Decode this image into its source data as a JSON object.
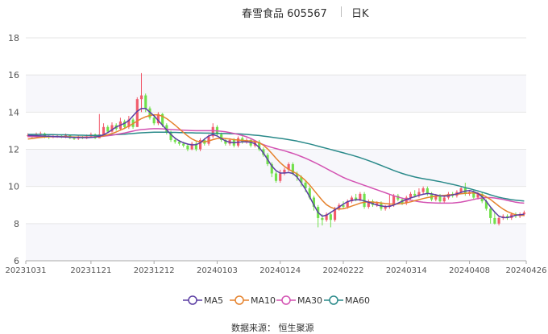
{
  "header": {
    "title": "春雪食品 605567",
    "period": "日K"
  },
  "source": "数据来源： 恒生聚源",
  "colors": {
    "up": "#f15b6c",
    "down": "#71e04b",
    "ma5": "#5b3ea3",
    "ma10": "#e5822d",
    "ma30": "#d352b2",
    "ma60": "#2a8a8a",
    "grid": "#e6e6e6",
    "plot_bg_odd": "#f7f7fb"
  },
  "chart_data": {
    "type": "candlestick",
    "ylim": [
      6,
      18
    ],
    "yticks": [
      "6",
      "8",
      "10",
      "12",
      "14",
      "16",
      "18"
    ],
    "xticks": [
      "20231031",
      "20231121",
      "20231212",
      "20240103",
      "20240124",
      "20240222",
      "20240314",
      "20240408",
      "20240426"
    ],
    "xtick_index": [
      0,
      15,
      30,
      45,
      60,
      75,
      90,
      105,
      117
    ],
    "legend": [
      "MA5",
      "MA10",
      "MA30",
      "MA60"
    ],
    "candles": [
      [
        12.75,
        12.75,
        12.86,
        12.65
      ],
      [
        12.75,
        12.7,
        12.8,
        12.6
      ],
      [
        12.7,
        12.8,
        12.9,
        12.65
      ],
      [
        12.8,
        12.85,
        12.95,
        12.75
      ],
      [
        12.85,
        12.7,
        12.9,
        12.6
      ],
      [
        12.7,
        12.65,
        12.8,
        12.55
      ],
      [
        12.65,
        12.7,
        12.8,
        12.6
      ],
      [
        12.7,
        12.72,
        12.82,
        12.62
      ],
      [
        12.72,
        12.68,
        12.8,
        12.6
      ],
      [
        12.68,
        12.75,
        12.85,
        12.6
      ],
      [
        12.75,
        12.6,
        12.8,
        12.55
      ],
      [
        12.6,
        12.58,
        12.7,
        12.5
      ],
      [
        12.58,
        12.66,
        12.75,
        12.5
      ],
      [
        12.66,
        12.6,
        12.72,
        12.55
      ],
      [
        12.6,
        12.7,
        12.8,
        12.55
      ],
      [
        12.7,
        12.8,
        12.9,
        12.65
      ],
      [
        12.8,
        12.6,
        12.85,
        12.55
      ],
      [
        12.6,
        12.8,
        13.9,
        12.6
      ],
      [
        12.8,
        13.2,
        13.4,
        12.75
      ],
      [
        13.2,
        12.95,
        13.3,
        12.9
      ],
      [
        12.95,
        13.3,
        13.45,
        12.9
      ],
      [
        13.3,
        13.1,
        13.4,
        13.0
      ],
      [
        13.1,
        13.5,
        13.7,
        13.0
      ],
      [
        13.5,
        13.2,
        13.6,
        13.1
      ],
      [
        13.2,
        13.6,
        13.8,
        13.1
      ],
      [
        13.6,
        13.2,
        13.7,
        13.1
      ],
      [
        13.2,
        14.7,
        14.8,
        13.2
      ],
      [
        14.7,
        14.9,
        16.1,
        14.0
      ],
      [
        14.9,
        14.2,
        15.0,
        14.0
      ],
      [
        14.2,
        13.7,
        14.3,
        13.6
      ],
      [
        13.7,
        13.4,
        13.8,
        13.3
      ],
      [
        13.4,
        13.9,
        14.0,
        13.3
      ],
      [
        13.9,
        13.3,
        13.95,
        13.2
      ],
      [
        13.3,
        12.9,
        13.4,
        12.8
      ],
      [
        12.9,
        12.5,
        13.0,
        12.4
      ],
      [
        12.5,
        12.4,
        12.6,
        12.3
      ],
      [
        12.4,
        12.3,
        12.5,
        12.2
      ],
      [
        12.3,
        12.2,
        12.4,
        12.1
      ],
      [
        12.2,
        12.0,
        12.3,
        11.9
      ],
      [
        12.0,
        12.3,
        12.4,
        11.95
      ],
      [
        12.3,
        12.0,
        12.4,
        11.9
      ],
      [
        12.0,
        12.5,
        12.6,
        11.9
      ],
      [
        12.5,
        12.3,
        12.6,
        12.2
      ],
      [
        12.3,
        12.7,
        12.8,
        12.2
      ],
      [
        12.7,
        13.2,
        13.4,
        12.6
      ],
      [
        13.2,
        12.8,
        13.3,
        12.7
      ],
      [
        12.8,
        12.5,
        12.9,
        12.4
      ],
      [
        12.5,
        12.3,
        12.6,
        12.2
      ],
      [
        12.3,
        12.5,
        12.6,
        12.2
      ],
      [
        12.5,
        12.2,
        12.6,
        12.1
      ],
      [
        12.2,
        12.6,
        12.7,
        12.1
      ],
      [
        12.6,
        12.4,
        12.7,
        12.3
      ],
      [
        12.4,
        12.5,
        12.6,
        12.3
      ],
      [
        12.5,
        12.2,
        12.6,
        12.1
      ],
      [
        12.2,
        12.4,
        12.5,
        12.1
      ],
      [
        12.4,
        12.0,
        12.5,
        11.9
      ],
      [
        12.0,
        11.7,
        12.1,
        11.6
      ],
      [
        11.7,
        11.2,
        11.8,
        11.1
      ],
      [
        11.2,
        10.7,
        11.3,
        10.5
      ],
      [
        10.7,
        10.3,
        10.8,
        10.2
      ],
      [
        10.3,
        10.7,
        10.9,
        10.2
      ],
      [
        10.7,
        10.9,
        11.0,
        10.6
      ],
      [
        10.9,
        11.2,
        11.3,
        10.8
      ],
      [
        11.2,
        10.7,
        11.3,
        10.6
      ],
      [
        10.7,
        10.5,
        10.8,
        10.3
      ],
      [
        10.5,
        10.2,
        10.6,
        10.0
      ],
      [
        10.2,
        9.9,
        10.3,
        9.7
      ],
      [
        9.9,
        9.4,
        10.0,
        9.3
      ],
      [
        9.4,
        8.9,
        9.5,
        8.7
      ],
      [
        8.9,
        8.3,
        9.0,
        7.8
      ],
      [
        8.3,
        8.2,
        8.5,
        7.9
      ],
      [
        8.2,
        8.5,
        8.6,
        8.1
      ],
      [
        8.5,
        8.2,
        8.6,
        7.8
      ],
      [
        8.2,
        8.8,
        8.9,
        8.1
      ],
      [
        8.8,
        9.0,
        9.1,
        8.7
      ],
      [
        9.0,
        8.9,
        9.2,
        8.8
      ],
      [
        8.9,
        9.2,
        9.3,
        8.8
      ],
      [
        9.2,
        9.4,
        9.5,
        9.1
      ],
      [
        9.4,
        9.3,
        9.6,
        9.2
      ],
      [
        9.3,
        9.6,
        9.7,
        9.2
      ],
      [
        9.6,
        8.9,
        9.7,
        8.8
      ],
      [
        8.9,
        9.2,
        9.3,
        8.8
      ],
      [
        9.2,
        9.0,
        9.3,
        8.9
      ],
      [
        9.0,
        9.1,
        9.2,
        8.9
      ],
      [
        9.1,
        8.8,
        9.2,
        8.7
      ],
      [
        8.8,
        8.9,
        9.0,
        8.7
      ],
      [
        8.9,
        9.0,
        9.6,
        8.8
      ],
      [
        9.0,
        9.5,
        9.6,
        8.9
      ],
      [
        9.5,
        9.3,
        9.6,
        9.2
      ],
      [
        9.3,
        9.1,
        9.4,
        9.0
      ],
      [
        9.1,
        9.4,
        9.5,
        9.0
      ],
      [
        9.4,
        9.6,
        9.7,
        9.3
      ],
      [
        9.6,
        9.5,
        9.8,
        9.4
      ],
      [
        9.5,
        9.7,
        9.9,
        9.4
      ],
      [
        9.7,
        9.9,
        10.0,
        9.6
      ],
      [
        9.9,
        9.6,
        10.0,
        9.5
      ],
      [
        9.6,
        9.3,
        9.7,
        9.2
      ],
      [
        9.3,
        9.5,
        9.6,
        9.2
      ],
      [
        9.5,
        9.2,
        9.6,
        9.1
      ],
      [
        9.2,
        9.4,
        9.5,
        9.1
      ],
      [
        9.4,
        9.6,
        9.7,
        9.3
      ],
      [
        9.6,
        9.5,
        9.7,
        9.4
      ],
      [
        9.5,
        9.7,
        9.8,
        9.4
      ],
      [
        9.7,
        9.9,
        10.0,
        9.6
      ],
      [
        9.9,
        9.6,
        10.2,
        9.5
      ],
      [
        9.6,
        9.7,
        9.8,
        9.5
      ],
      [
        9.7,
        9.4,
        9.8,
        9.3
      ],
      [
        9.4,
        9.6,
        9.7,
        9.3
      ],
      [
        9.6,
        9.2,
        9.7,
        9.1
      ],
      [
        9.2,
        8.8,
        9.3,
        8.7
      ],
      [
        8.8,
        8.3,
        8.9,
        8.0
      ],
      [
        8.3,
        8.0,
        8.6,
        7.95
      ],
      [
        8.0,
        8.3,
        8.4,
        7.9
      ],
      [
        8.3,
        8.4,
        8.5,
        8.2
      ],
      [
        8.4,
        8.3,
        8.5,
        8.2
      ],
      [
        8.3,
        8.5,
        8.6,
        8.2
      ],
      [
        8.5,
        8.4,
        8.6,
        8.3
      ],
      [
        8.4,
        8.5,
        8.6,
        8.3
      ],
      [
        8.5,
        8.6,
        8.7,
        8.4
      ]
    ],
    "ma5": [
      12.75,
      12.74,
      12.73,
      12.72,
      12.71,
      12.7,
      12.69,
      12.68,
      12.67,
      12.66,
      12.65,
      12.64,
      12.64,
      12.63,
      12.63,
      12.64,
      12.66,
      12.7,
      12.78,
      12.9,
      13.05,
      13.2,
      13.3,
      13.4,
      13.55,
      13.8,
      14.05,
      14.2,
      14.2,
      14.0,
      13.8,
      13.55,
      13.3,
      13.05,
      12.8,
      12.6,
      12.45,
      12.35,
      12.28,
      12.24,
      12.25,
      12.35,
      12.55,
      12.72,
      12.8,
      12.72,
      12.58,
      12.45,
      12.38,
      12.35,
      12.38,
      12.4,
      12.4,
      12.38,
      12.3,
      12.1,
      11.8,
      11.45,
      11.1,
      10.85,
      10.72,
      10.72,
      10.75,
      10.7,
      10.5,
      10.2,
      9.85,
      9.45,
      9.0,
      8.6,
      8.4,
      8.45,
      8.6,
      8.75,
      8.9,
      9.05,
      9.18,
      9.25,
      9.28,
      9.28,
      9.22,
      9.15,
      9.08,
      9.0,
      8.95,
      8.92,
      8.93,
      9.0,
      9.1,
      9.2,
      9.3,
      9.38,
      9.45,
      9.52,
      9.58,
      9.62,
      9.6,
      9.55,
      9.5,
      9.48,
      9.5,
      9.55,
      9.6,
      9.68,
      9.75,
      9.78,
      9.72,
      9.62,
      9.45,
      9.2,
      8.9,
      8.62,
      8.4,
      8.32,
      8.32,
      8.38,
      8.45,
      8.48,
      8.5
    ],
    "ma10": [
      12.55,
      12.58,
      12.61,
      12.64,
      12.66,
      12.67,
      12.68,
      12.68,
      12.68,
      12.68,
      12.67,
      12.66,
      12.66,
      12.65,
      12.65,
      12.65,
      12.66,
      12.68,
      12.72,
      12.78,
      12.85,
      12.93,
      13.03,
      13.13,
      13.25,
      13.38,
      13.52,
      13.65,
      13.75,
      13.82,
      13.86,
      13.85,
      13.78,
      13.65,
      13.48,
      13.3,
      13.1,
      12.9,
      12.72,
      12.56,
      12.45,
      12.4,
      12.4,
      12.45,
      12.52,
      12.58,
      12.6,
      12.58,
      12.55,
      12.52,
      12.5,
      12.48,
      12.46,
      12.44,
      12.42,
      12.35,
      12.22,
      12.02,
      11.78,
      11.52,
      11.28,
      11.08,
      10.92,
      10.8,
      10.68,
      10.52,
      10.32,
      10.08,
      9.8,
      9.52,
      9.25,
      9.02,
      8.88,
      8.8,
      8.78,
      8.8,
      8.86,
      8.94,
      9.02,
      9.1,
      9.15,
      9.17,
      9.16,
      9.14,
      9.11,
      9.08,
      9.06,
      9.05,
      9.06,
      9.08,
      9.12,
      9.17,
      9.23,
      9.29,
      9.35,
      9.4,
      9.44,
      9.47,
      9.5,
      9.52,
      9.54,
      9.56,
      9.58,
      9.61,
      9.63,
      9.65,
      9.65,
      9.62,
      9.55,
      9.44,
      9.3,
      9.12,
      8.94,
      8.78,
      8.65,
      8.55,
      8.48,
      8.45,
      8.44
    ],
    "ma30": [
      12.68,
      12.68,
      12.68,
      12.68,
      12.68,
      12.68,
      12.67,
      12.67,
      12.67,
      12.67,
      12.66,
      12.66,
      12.66,
      12.66,
      12.66,
      12.66,
      12.67,
      12.68,
      12.7,
      12.73,
      12.76,
      12.8,
      12.84,
      12.88,
      12.93,
      12.98,
      13.03,
      13.06,
      13.08,
      13.1,
      13.11,
      13.11,
      13.1,
      13.08,
      13.06,
      13.05,
      13.04,
      13.03,
      13.02,
      13.01,
      13.0,
      13.0,
      13.0,
      13.0,
      13.0,
      12.99,
      12.97,
      12.94,
      12.9,
      12.85,
      12.8,
      12.74,
      12.67,
      12.58,
      12.47,
      12.35,
      12.25,
      12.17,
      12.1,
      12.04,
      11.98,
      11.92,
      11.85,
      11.78,
      11.7,
      11.61,
      11.52,
      11.42,
      11.31,
      11.2,
      11.08,
      10.96,
      10.84,
      10.72,
      10.6,
      10.49,
      10.39,
      10.3,
      10.22,
      10.14,
      10.06,
      9.98,
      9.9,
      9.82,
      9.74,
      9.66,
      9.58,
      9.5,
      9.43,
      9.37,
      9.31,
      9.26,
      9.22,
      9.18,
      9.15,
      9.13,
      9.12,
      9.11,
      9.1,
      9.1,
      9.1,
      9.11,
      9.13,
      9.16,
      9.2,
      9.25,
      9.3,
      9.35,
      9.38,
      9.4,
      9.4,
      9.38,
      9.34,
      9.3,
      9.25,
      9.2,
      9.15,
      9.12,
      9.1
    ],
    "ma60": [
      12.8,
      12.8,
      12.8,
      12.8,
      12.79,
      12.79,
      12.79,
      12.78,
      12.78,
      12.78,
      12.77,
      12.77,
      12.76,
      12.76,
      12.75,
      12.75,
      12.75,
      12.75,
      12.76,
      12.77,
      12.78,
      12.79,
      12.8,
      12.81,
      12.83,
      12.85,
      12.87,
      12.89,
      12.9,
      12.91,
      12.92,
      12.92,
      12.92,
      12.92,
      12.91,
      12.91,
      12.9,
      12.9,
      12.89,
      12.89,
      12.88,
      12.88,
      12.87,
      12.87,
      12.86,
      12.86,
      12.85,
      12.85,
      12.84,
      12.84,
      12.83,
      12.82,
      12.8,
      12.78,
      12.76,
      12.74,
      12.71,
      12.68,
      12.65,
      12.62,
      12.59,
      12.56,
      12.52,
      12.48,
      12.44,
      12.39,
      12.34,
      12.29,
      12.23,
      12.17,
      12.11,
      12.05,
      11.99,
      11.93,
      11.87,
      11.81,
      11.75,
      11.69,
      11.62,
      11.55,
      11.47,
      11.39,
      11.31,
      11.22,
      11.13,
      11.04,
      10.95,
      10.86,
      10.78,
      10.7,
      10.63,
      10.57,
      10.51,
      10.46,
      10.42,
      10.38,
      10.34,
      10.3,
      10.26,
      10.21,
      10.16,
      10.11,
      10.06,
      10.0,
      9.94,
      9.88,
      9.82,
      9.76,
      9.69,
      9.62,
      9.55,
      9.48,
      9.42,
      9.37,
      9.33,
      9.29,
      9.26,
      9.24,
      9.22
    ]
  }
}
